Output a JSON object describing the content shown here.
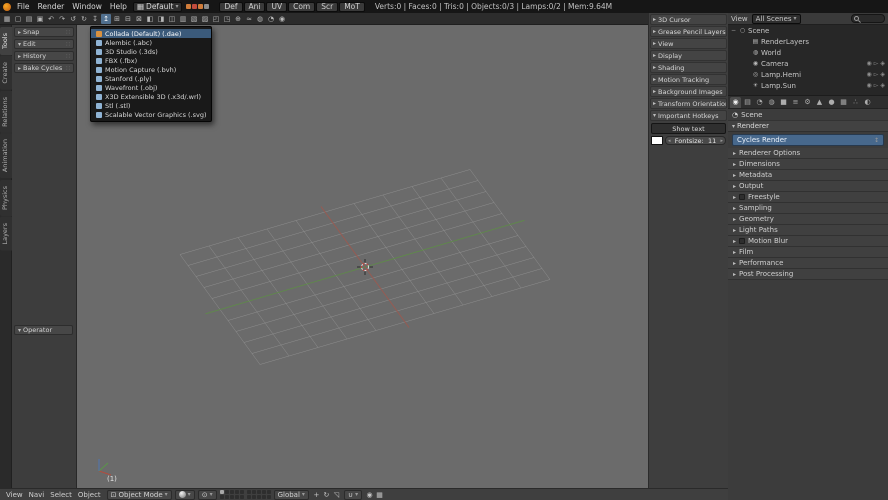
{
  "icons": {
    "chevron_down": "▾",
    "screen": "▦",
    "updown": "↕",
    "mode_cube": "⊡",
    "pivot": "⊙",
    "snap_magnet": "∪",
    "scene_breadcrumb": "◔",
    "panel_grip": "∷"
  },
  "info_bar": {
    "menus": [
      "File",
      "Render",
      "Window",
      "Help"
    ],
    "layout_name": "Default",
    "layer_dots": [
      "#d07c3a",
      "#c14b3e",
      "#d07c3a",
      "#8b8b8b"
    ],
    "workspaces": [
      "Def",
      "Ani",
      "UV",
      "Com",
      "Scr",
      "MoT"
    ],
    "stats": "Verts:0 | Faces:0 | Tris:0 | Objects:0/3 | Lamps:0/2 | Mem:9.64M"
  },
  "icon_toolbar": {
    "buttons": [
      {
        "name": "editor-type-icon",
        "glyph": "▦"
      },
      {
        "name": "new-file-icon",
        "glyph": "▢"
      },
      {
        "name": "open-file-icon",
        "glyph": "▤"
      },
      {
        "name": "save-file-icon",
        "glyph": "▣"
      },
      {
        "name": "undo-icon",
        "glyph": "↶"
      },
      {
        "name": "redo-icon",
        "glyph": "↷"
      },
      {
        "name": "undo-history-icon",
        "glyph": "↺"
      },
      {
        "name": "repeat-icon",
        "glyph": "↻"
      },
      {
        "name": "import-icon",
        "glyph": "↧"
      },
      {
        "name": "export-icon",
        "glyph": "↥",
        "active": true
      },
      {
        "name": "link-icon",
        "glyph": "⊞"
      },
      {
        "name": "append-icon",
        "glyph": "⊟"
      },
      {
        "name": "pack-icon",
        "glyph": "⊠"
      },
      {
        "name": "copy-icon",
        "glyph": "◧"
      },
      {
        "name": "paste-icon",
        "glyph": "◨"
      },
      {
        "name": "duplicate-icon",
        "glyph": "◫"
      },
      {
        "name": "delete-icon",
        "glyph": "▥"
      },
      {
        "name": "mirror-x-icon",
        "glyph": "▧"
      },
      {
        "name": "mirror-y-icon",
        "glyph": "▨"
      },
      {
        "name": "view-front-icon",
        "glyph": "◰"
      },
      {
        "name": "view-side-icon",
        "glyph": "◳"
      },
      {
        "name": "add-object-icon",
        "glyph": "⊕"
      },
      {
        "name": "smooth-icon",
        "glyph": "≈"
      },
      {
        "name": "shade-icon",
        "glyph": "◍"
      },
      {
        "name": "wire-icon",
        "glyph": "◔"
      },
      {
        "name": "render-icon",
        "glyph": "◉"
      }
    ]
  },
  "export_menu": {
    "items": [
      {
        "label": "Collada (Default) (.dae)",
        "icon_color": "#d8913f",
        "highlight": true
      },
      {
        "label": "Alembic (.abc)",
        "icon_color": "#8fb3d4"
      },
      {
        "label": "3D Studio (.3ds)",
        "icon_color": "#8fb3d4"
      },
      {
        "label": "FBX (.fbx)",
        "icon_color": "#8fb3d4"
      },
      {
        "label": "Motion Capture (.bvh)",
        "icon_color": "#8fb3d4"
      },
      {
        "label": "Stanford (.ply)",
        "icon_color": "#8fb3d4"
      },
      {
        "label": "Wavefront (.obj)",
        "icon_color": "#8fb3d4"
      },
      {
        "label": "X3D Extensible 3D (.x3d/.wrl)",
        "icon_color": "#8fb3d4"
      },
      {
        "label": "Stl (.stl)",
        "icon_color": "#8fb3d4"
      },
      {
        "label": "Scalable Vector Graphics (.svg)",
        "icon_color": "#8fb3d4"
      }
    ]
  },
  "tool_shelf": {
    "tabs": [
      {
        "label": "Tools",
        "active": true
      },
      {
        "label": "Create"
      },
      {
        "label": "Relations"
      },
      {
        "label": "Animation"
      },
      {
        "label": "Physics"
      },
      {
        "label": "Layers"
      }
    ],
    "panels": [
      {
        "label": "Snap"
      },
      {
        "label": "Edit",
        "expanded": true
      },
      {
        "label": "History"
      },
      {
        "label": "Bake Cycles"
      }
    ],
    "operator_label": "Operator"
  },
  "viewport": {
    "layer_indicator": "(1)"
  },
  "n_panel": {
    "sections": [
      {
        "label": "3D Cursor"
      },
      {
        "label": "Grease Pencil Layers"
      },
      {
        "label": "View"
      },
      {
        "label": "Display"
      },
      {
        "label": "Shading"
      },
      {
        "label": "Motion Tracking"
      },
      {
        "label": "Background Images"
      },
      {
        "label": "Transform Orientations"
      },
      {
        "label": "Important Hotkeys",
        "expanded": true
      }
    ],
    "show_text_button": "Show text",
    "fontsize_label": "Fontsize:",
    "fontsize_value": "11"
  },
  "outliner": {
    "view_menu": "View",
    "display_mode": "All Scenes",
    "toggle_icons": [
      "◉",
      "▻",
      "◈"
    ],
    "items": [
      {
        "label": "Scene",
        "expander": "−",
        "icon_glyph": "○"
      },
      {
        "label": "RenderLayers",
        "depth": 1,
        "icon_glyph": "▤"
      },
      {
        "label": "World",
        "depth": 1,
        "icon_glyph": "◍"
      },
      {
        "label": "Camera",
        "depth": 1,
        "icon_glyph": "◉",
        "toggles": true
      },
      {
        "label": "Lamp.Hemi",
        "depth": 1,
        "icon_glyph": "◎",
        "toggles": true
      },
      {
        "label": "Lamp.Sun",
        "depth": 1,
        "icon_glyph": "☀",
        "toggles": true
      }
    ]
  },
  "properties": {
    "tabs": [
      {
        "name": "tab-render",
        "glyph": "◉",
        "active": true
      },
      {
        "name": "tab-render-layers",
        "glyph": "▤"
      },
      {
        "name": "tab-scene",
        "glyph": "◔"
      },
      {
        "name": "tab-world",
        "glyph": "◍"
      },
      {
        "name": "tab-object",
        "glyph": "■"
      },
      {
        "name": "tab-constraints",
        "glyph": "≡"
      },
      {
        "name": "tab-modifiers",
        "glyph": "⚙"
      },
      {
        "name": "tab-data",
        "glyph": "▲"
      },
      {
        "name": "tab-material",
        "glyph": "●"
      },
      {
        "name": "tab-texture",
        "glyph": "▦"
      },
      {
        "name": "tab-particles",
        "glyph": "∴"
      },
      {
        "name": "tab-physics",
        "glyph": "◐"
      }
    ],
    "breadcrumb": "Scene",
    "renderer_section": "Renderer",
    "engine": "Cycles Render",
    "panels": [
      {
        "label": "Renderer Options"
      },
      {
        "label": "Dimensions"
      },
      {
        "label": "Metadata"
      },
      {
        "label": "Output"
      },
      {
        "label": "Freestyle",
        "checkbox": true
      },
      {
        "label": "Sampling"
      },
      {
        "label": "Geometry"
      },
      {
        "label": "Light Paths"
      },
      {
        "label": "Motion Blur",
        "checkbox": true
      },
      {
        "label": "Film"
      },
      {
        "label": "Performance"
      },
      {
        "label": "Post Processing"
      }
    ]
  },
  "bottom_bar": {
    "menus": [
      "View",
      "Navi",
      "Select",
      "Object"
    ],
    "mode": "Object Mode",
    "orientation": "Global",
    "manip_icons": [
      {
        "name": "manipulator-translate-icon",
        "glyph": "+"
      },
      {
        "name": "manipulator-rotate-icon",
        "glyph": "↻"
      },
      {
        "name": "manipulator-scale-icon",
        "glyph": "◹"
      }
    ],
    "right_icons": [
      {
        "name": "opengl-render-icon",
        "glyph": "◉"
      },
      {
        "name": "opengl-render-anim-icon",
        "glyph": "▦"
      }
    ]
  }
}
